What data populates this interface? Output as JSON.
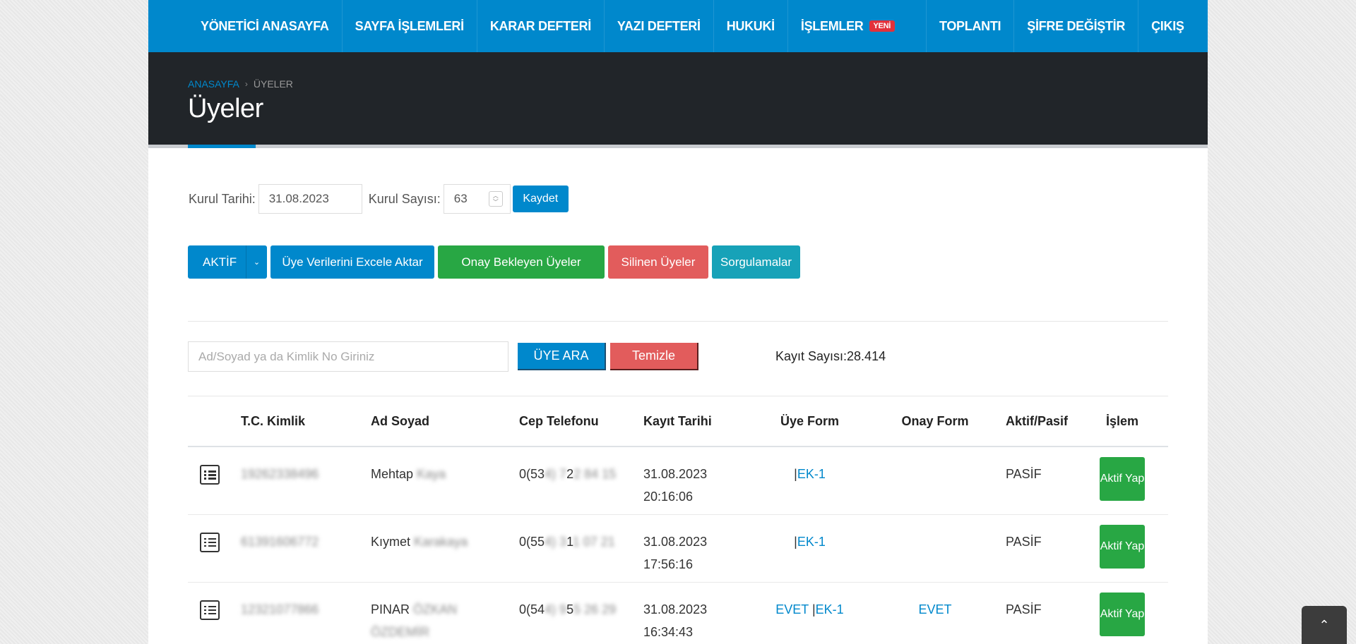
{
  "nav": {
    "items": [
      {
        "label": "YÖNETİCİ ANASAYFA"
      },
      {
        "label": "SAYFA İŞLEMLERİ"
      },
      {
        "label": "KARAR DEFTERİ"
      },
      {
        "label": "YAZI DEFTERİ"
      },
      {
        "label": "HUKUKİ"
      },
      {
        "label": "İŞLEMLER",
        "badge": "YENİ"
      },
      {
        "label": "TOPLANTI"
      },
      {
        "label": "ŞİFRE DEĞİŞTİR"
      },
      {
        "label": "ÇIKIŞ"
      }
    ]
  },
  "breadcrumb": {
    "home": "ANASAYFA",
    "separator": "›",
    "current": "ÜYELER"
  },
  "page_title": "Üyeler",
  "kurul": {
    "date_label": "Kurul Tarihi:",
    "date_value": "31.08.2023",
    "count_label": "Kurul Sayısı:",
    "count_value": "63",
    "save_label": "Kaydet"
  },
  "actions": {
    "status": "AKTİF",
    "export": "Üye Verilerini Excele Aktar",
    "pending": "Onay Bekleyen Üyeler",
    "deleted": "Silinen Üyeler",
    "queries": "Sorgulamalar"
  },
  "search": {
    "placeholder": "Ad/Soyad ya da Kimlik No Giriniz",
    "search_label": "ÜYE ARA",
    "clear_label": "Temizle",
    "count_text": "Kayıt Sayısı:28.414"
  },
  "table": {
    "headers": [
      "",
      "T.C. Kimlik",
      "Ad Soyad",
      "Cep Telefonu",
      "Kayıt Tarihi",
      "Üye Form",
      "Onay Form",
      "Aktif/Pasif",
      "İşlem"
    ],
    "rows": [
      {
        "tc": "19262338496",
        "first": "Mehtap",
        "last": "Kaya",
        "phone_a": "0(53",
        "phone_b": "4) 7",
        "phone_c": "2",
        "phone_d": "2 84 15",
        "date": "31.08.2023",
        "time": "20:16:06",
        "uye_evet": "",
        "uye_sep": "|",
        "uye_ek": "EK-1",
        "onay": "",
        "status": "PASİF",
        "action": "Aktif Yap"
      },
      {
        "tc": "61391606772",
        "first": "Kıymet",
        "last": "Karakaya",
        "phone_a": "0(55",
        "phone_b": "4) 3",
        "phone_c": "1",
        "phone_d": "1 07 21",
        "date": "31.08.2023",
        "time": "17:56:16",
        "uye_evet": "",
        "uye_sep": "|",
        "uye_ek": "EK-1",
        "onay": "",
        "status": "PASİF",
        "action": "Aktif Yap"
      },
      {
        "tc": "12321077866",
        "first": "PINAR",
        "last": "ÖZKAN",
        "last2": "ÖZDEMİR",
        "phone_a": "0(54",
        "phone_b": "4) 9",
        "phone_c": "5",
        "phone_d": "5 26 29",
        "date": "31.08.2023",
        "time": "16:34:43",
        "uye_evet": "EVET",
        "uye_sep": "|",
        "uye_ek": "EK-1",
        "onay": "EVET",
        "status": "PASİF",
        "action": "Aktif Yap"
      }
    ]
  },
  "colors": {
    "primary": "#0088cc",
    "success": "#28a744",
    "danger": "#e25c5c",
    "info": "#17a2b8",
    "header_dark": "#212529"
  }
}
